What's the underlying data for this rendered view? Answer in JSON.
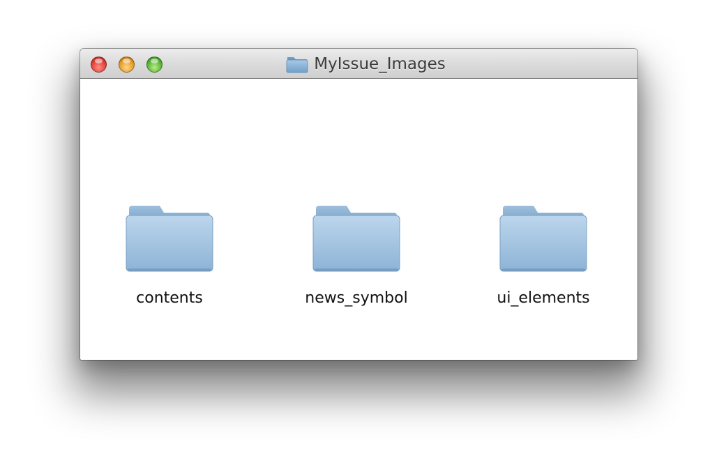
{
  "window": {
    "title": "MyIssue_Images",
    "title_icon": "folder-icon"
  },
  "titlebar_buttons": [
    {
      "name": "close",
      "color": "#e0443a"
    },
    {
      "name": "minimize",
      "color": "#e79d2a"
    },
    {
      "name": "zoom",
      "color": "#5db63a"
    }
  ],
  "items": [
    {
      "label": "contents",
      "icon": "folder-icon"
    },
    {
      "label": "news_symbol",
      "icon": "folder-icon"
    },
    {
      "label": "ui_elements",
      "icon": "folder-icon"
    }
  ],
  "colors": {
    "folder_blue": "#8fb5d6",
    "folder_tab": "#7ea7cc"
  }
}
